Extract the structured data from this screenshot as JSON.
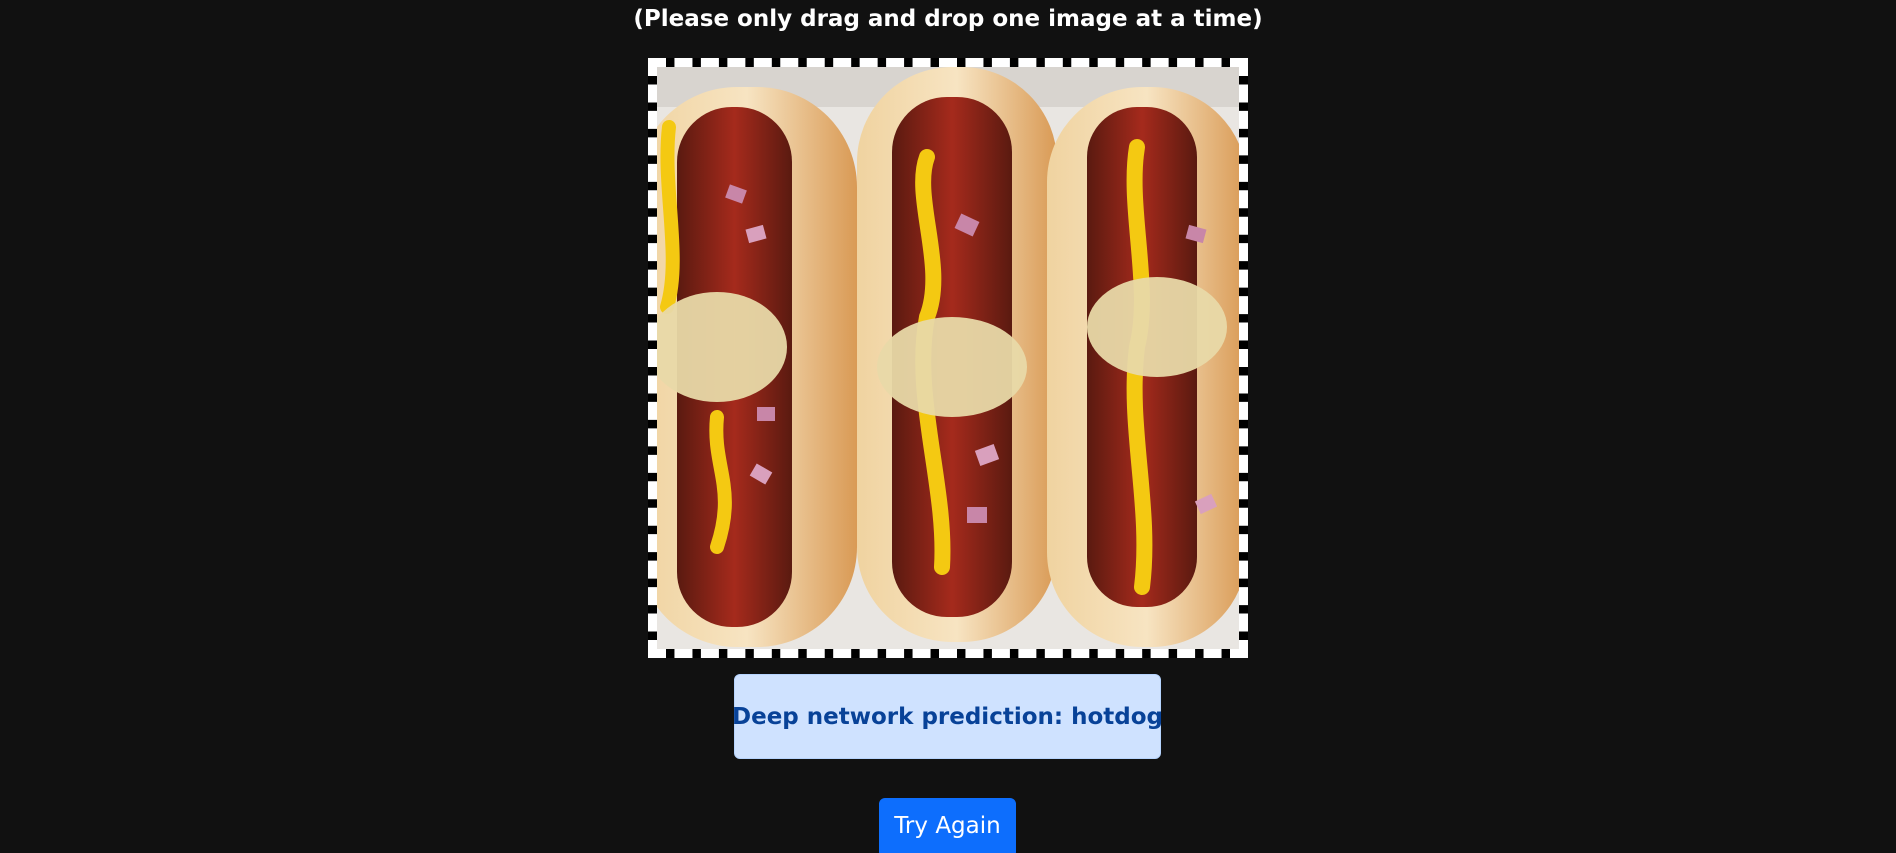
{
  "instruction": "(Please only drag and drop one image at a time)",
  "image": {
    "subject": "three hotdogs in buns with ketchup, mustard, sauerkraut and red onion"
  },
  "prediction": {
    "text": "Deep network prediction: hotdog"
  },
  "try_again_label": "Try Again",
  "colors": {
    "background": "#111111",
    "prediction_bg": "#cfe2ff",
    "prediction_text": "#084298",
    "button_bg": "#0d6efd"
  }
}
